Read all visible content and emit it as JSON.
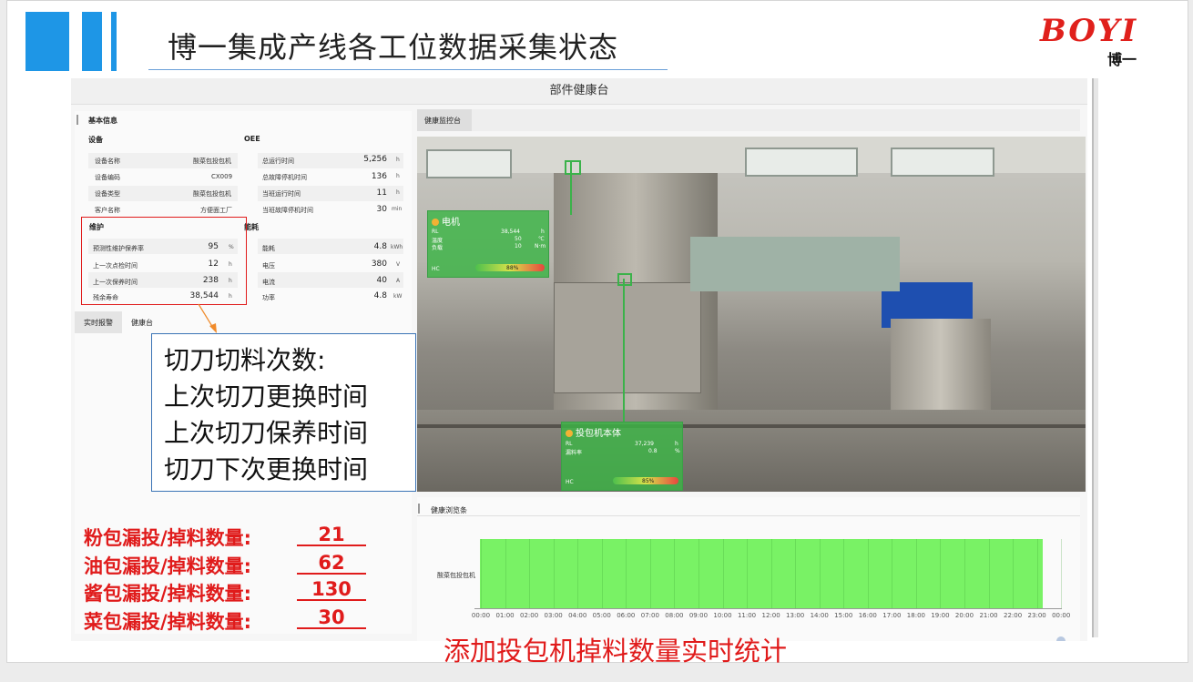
{
  "slide": {
    "title": "博一集成产线各工位数据采集状态",
    "logo_text": "BOYI",
    "logo_sub": "博一",
    "bottom_note": "添加投包机掉料数量实时统计"
  },
  "app": {
    "header_title": "部件健康台",
    "basic_info": {
      "section_title": "基本信息",
      "device_col": "设备",
      "oee_col": "OEE",
      "rows": [
        {
          "label": "设备名称",
          "value": "酸菜包投包机",
          "oee_label": "总运行时间",
          "oee_value": "5,256",
          "oee_unit": "h"
        },
        {
          "label": "设备编码",
          "value": "CX009",
          "oee_label": "总故障停机时间",
          "oee_value": "136",
          "oee_unit": "h"
        },
        {
          "label": "设备类型",
          "value": "酸菜包投包机",
          "oee_label": "当班运行时间",
          "oee_value": "11",
          "oee_unit": "h"
        },
        {
          "label": "客户名称",
          "value": "方便面工厂",
          "oee_label": "当班故障停机时间",
          "oee_value": "30",
          "oee_unit": "min"
        }
      ]
    },
    "maintenance": {
      "section_title": "维护",
      "rows": [
        {
          "label": "预测性维护保养率",
          "value": "95",
          "unit": "%"
        },
        {
          "label": "上一次点检时间",
          "value": "12",
          "unit": "h"
        },
        {
          "label": "上一次保养时间",
          "value": "238",
          "unit": "h"
        },
        {
          "label": "残余寿命",
          "value": "38,544",
          "unit": "h"
        }
      ]
    },
    "energy": {
      "section_title": "能耗",
      "rows": [
        {
          "label": "能耗",
          "value": "4.8",
          "unit": "kWh"
        },
        {
          "label": "电压",
          "value": "380",
          "unit": "V"
        },
        {
          "label": "电流",
          "value": "40",
          "unit": "A"
        },
        {
          "label": "功率",
          "value": "4.8",
          "unit": "kW"
        }
      ]
    },
    "tabs": {
      "tab1": "实时报警",
      "tab2": "健康台"
    },
    "monitor_tab": "健康监控台",
    "overlay_motor": {
      "title": "电机",
      "rows": [
        {
          "label": "RL",
          "value": "38,544",
          "unit": "h"
        },
        {
          "label": "温度",
          "value": "50",
          "unit": "℃"
        },
        {
          "label": "负载",
          "value": "10",
          "unit": "N·m"
        }
      ],
      "hc_label": "HC",
      "hc_value": "88%",
      "hc_percent": 88
    },
    "overlay_body": {
      "title": "投包机本体",
      "rows": [
        {
          "label": "RL",
          "value": "37,239",
          "unit": "h"
        },
        {
          "label": "漏料率",
          "value": "0.8",
          "unit": "%"
        }
      ],
      "hc_label": "HC",
      "hc_value": "85%",
      "hc_percent": 85
    },
    "health_browse": {
      "title": "健康浏览条",
      "row_label": "酸菜包投包机",
      "time_ticks": [
        "00:00",
        "01:00",
        "02:00",
        "03:00",
        "04:00",
        "05:00",
        "06:00",
        "07:00",
        "08:00",
        "09:00",
        "10:00",
        "11:00",
        "12:00",
        "13:00",
        "14:00",
        "15:00",
        "16:00",
        "17:00",
        "18:00",
        "19:00",
        "20:00",
        "21:00",
        "22:00",
        "23:00",
        "00:00"
      ],
      "bar_color": "#79f265"
    }
  },
  "annotation": {
    "lines": [
      "切刀切料次数:",
      "上次切刀更换时间",
      "上次切刀保养时间",
      "切刀下次更换时间"
    ]
  },
  "counts": [
    {
      "label": "粉包漏投/掉料数量:",
      "value": "21"
    },
    {
      "label": "油包漏投/掉料数量:",
      "value": "62"
    },
    {
      "label": "酱包漏投/掉料数量:",
      "value": "130"
    },
    {
      "label": "菜包漏投/掉料数量:",
      "value": "30"
    }
  ]
}
